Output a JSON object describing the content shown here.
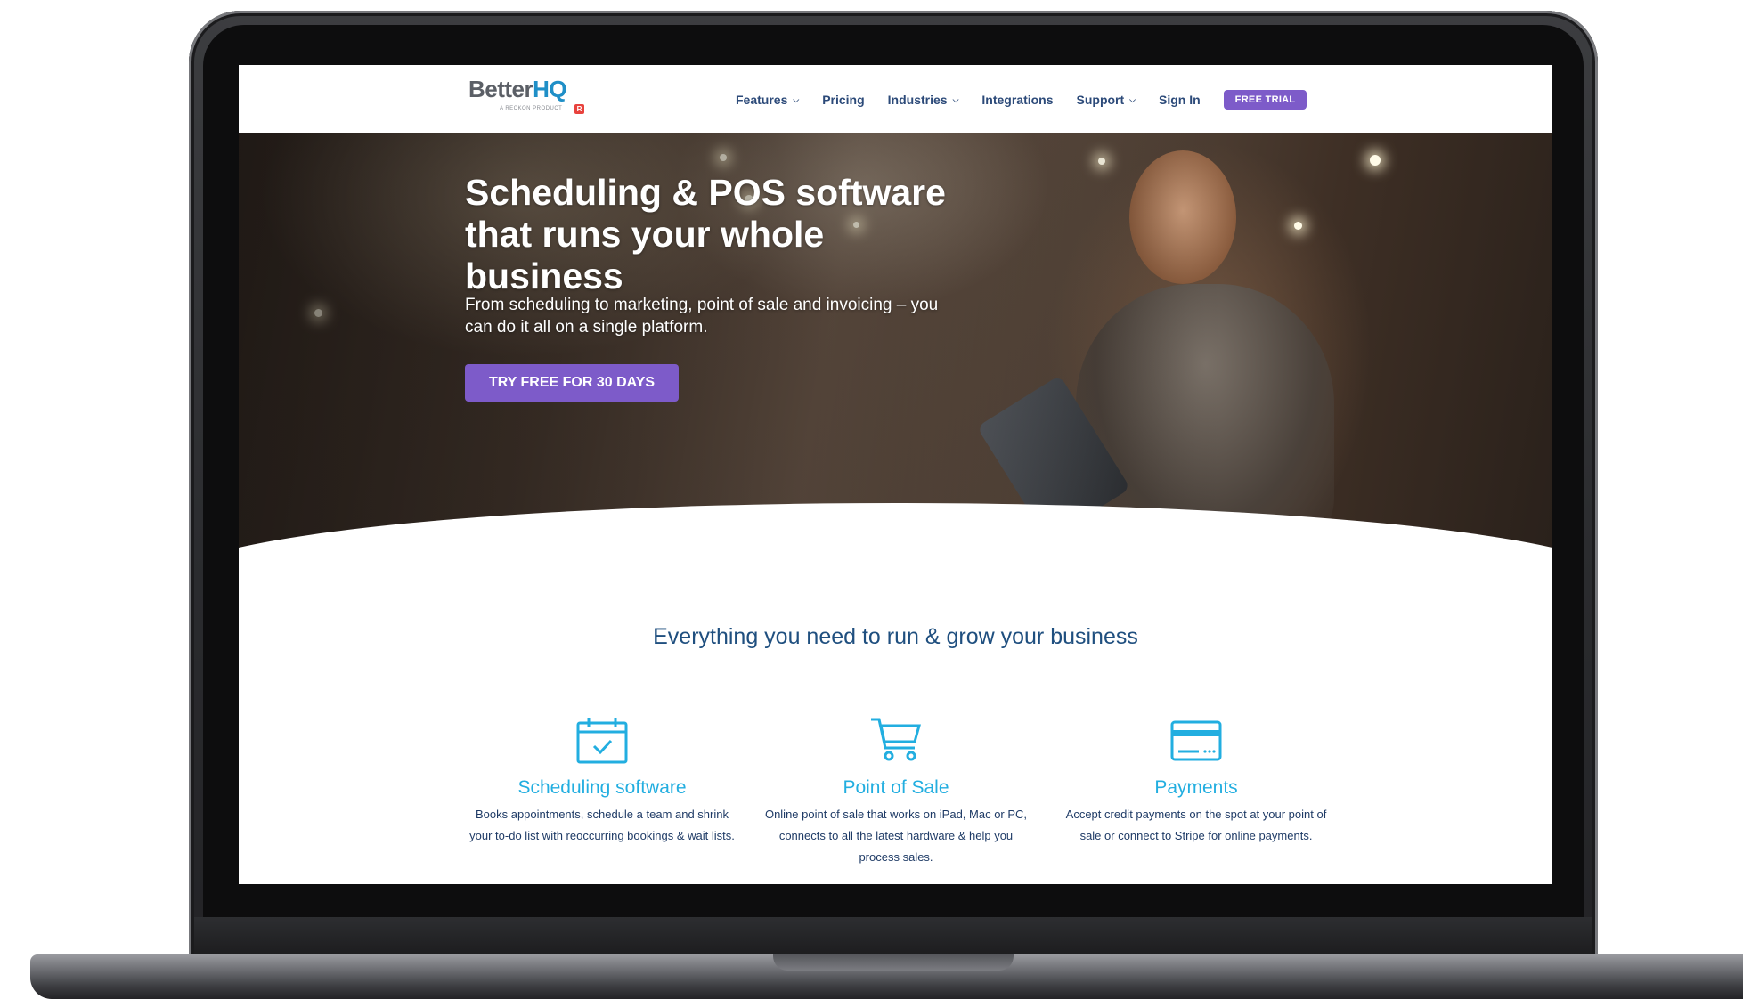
{
  "logo": {
    "text_main": "Better",
    "text_accent": "HQ",
    "tagline": "A RECKON PRODUCT",
    "badge": "R"
  },
  "nav": {
    "items": [
      {
        "label": "Features",
        "has_dropdown": true
      },
      {
        "label": "Pricing",
        "has_dropdown": false
      },
      {
        "label": "Industries",
        "has_dropdown": true
      },
      {
        "label": "Integrations",
        "has_dropdown": false
      },
      {
        "label": "Support",
        "has_dropdown": true
      },
      {
        "label": "Sign In",
        "has_dropdown": false
      }
    ],
    "cta": "FREE TRIAL"
  },
  "hero": {
    "title": "Scheduling & POS software that runs your whole business",
    "subtitle": "From scheduling to marketing, point of sale and invoicing – you can do it all on a single platform.",
    "cta": "TRY FREE FOR 30 DAYS"
  },
  "features_section": {
    "title": "Everything you need to run & grow your business",
    "items": [
      {
        "icon": "calendar-check-icon",
        "title": "Scheduling software",
        "desc": "Books appointments, schedule a team and shrink your to-do list with reoccurring bookings & wait lists."
      },
      {
        "icon": "shopping-cart-icon",
        "title": "Point of Sale",
        "desc": "Online point of sale that works on iPad, Mac or PC, connects to all the latest hardware & help you process sales."
      },
      {
        "icon": "credit-card-icon",
        "title": "Payments",
        "desc": "Accept credit payments on the spot at your point of sale or connect to Stripe for online payments."
      }
    ]
  },
  "colors": {
    "accent_purple": "#7d5bc9",
    "nav_text": "#2c4a79",
    "feature_blue": "#22aee0",
    "heading_navy": "#1f4f7f"
  }
}
